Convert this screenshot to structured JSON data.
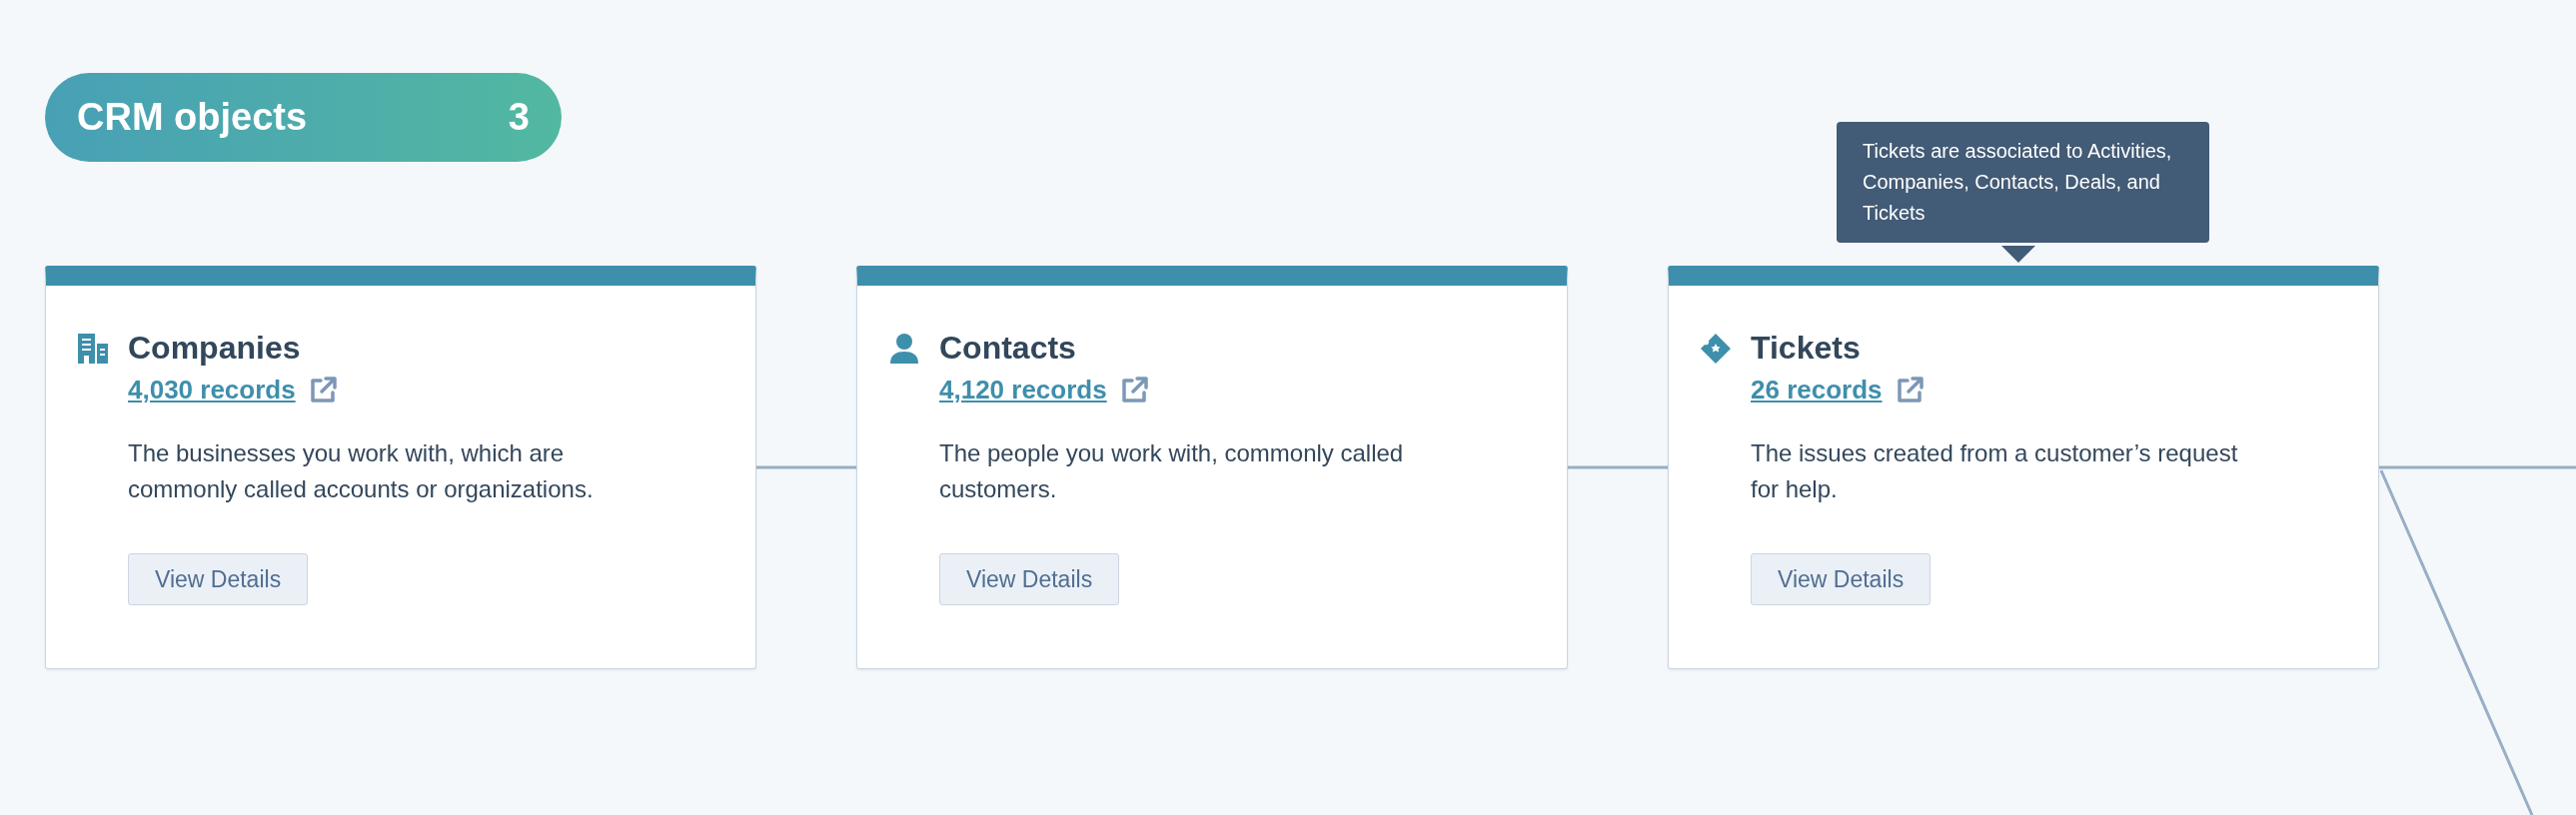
{
  "header_badge": {
    "label": "CRM objects",
    "count": "3"
  },
  "objects": [
    {
      "kind": "building",
      "title": "Companies",
      "records_link": "4,030 records",
      "description": "The businesses you work with, which are commonly called accounts or organizations.",
      "button": "View Details"
    },
    {
      "kind": "person",
      "title": "Contacts",
      "records_link": "4,120 records",
      "description": "The people you work with, commonly called customers.",
      "button": "View Details"
    },
    {
      "kind": "ticket",
      "title": "Tickets",
      "records_link": "26 records",
      "description": "The issues created from a customer’s request for help.",
      "button": "View Details"
    }
  ],
  "tooltip": {
    "text": "Tickets are associated to Activities, Companies, Contacts, Deals, and Tickets"
  }
}
